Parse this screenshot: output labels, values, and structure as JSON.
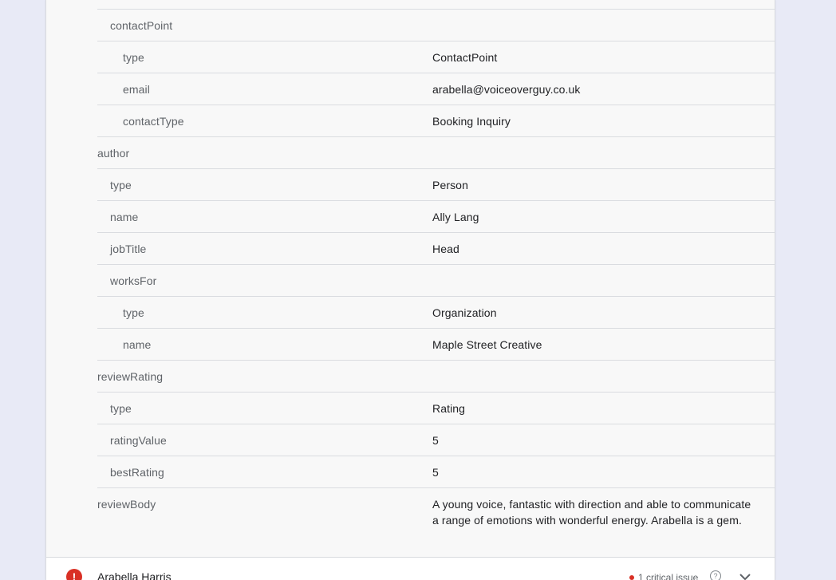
{
  "rows": [
    {
      "key": "contactPoint",
      "value": ""
    },
    {
      "key": "type",
      "value": "ContactPoint"
    },
    {
      "key": "email",
      "value": "arabella@voiceoverguy.co.uk"
    },
    {
      "key": "contactType",
      "value": "Booking Inquiry"
    },
    {
      "key": "author",
      "value": ""
    },
    {
      "key": "type",
      "value": "Person"
    },
    {
      "key": "name",
      "value": "Ally Lang"
    },
    {
      "key": "jobTitle",
      "value": "Head"
    },
    {
      "key": "worksFor",
      "value": ""
    },
    {
      "key": "type",
      "value": "Organization"
    },
    {
      "key": "name",
      "value": "Maple Street Creative"
    },
    {
      "key": "reviewRating",
      "value": ""
    },
    {
      "key": "type",
      "value": "Rating"
    },
    {
      "key": "ratingValue",
      "value": "5"
    },
    {
      "key": "bestRating",
      "value": "5"
    },
    {
      "key": "reviewBody",
      "value": "A young voice, fantastic with direction and able to communicate a range of emotions with wonderful energy. Arabella is a gem."
    }
  ],
  "footer": {
    "item_name": "Arabella Harris",
    "issue_text": "1 critical issue",
    "error_icon": "error-icon",
    "help_icon": "help-icon",
    "expand_icon": "chevron-down-icon",
    "error_color": "#d93025"
  }
}
